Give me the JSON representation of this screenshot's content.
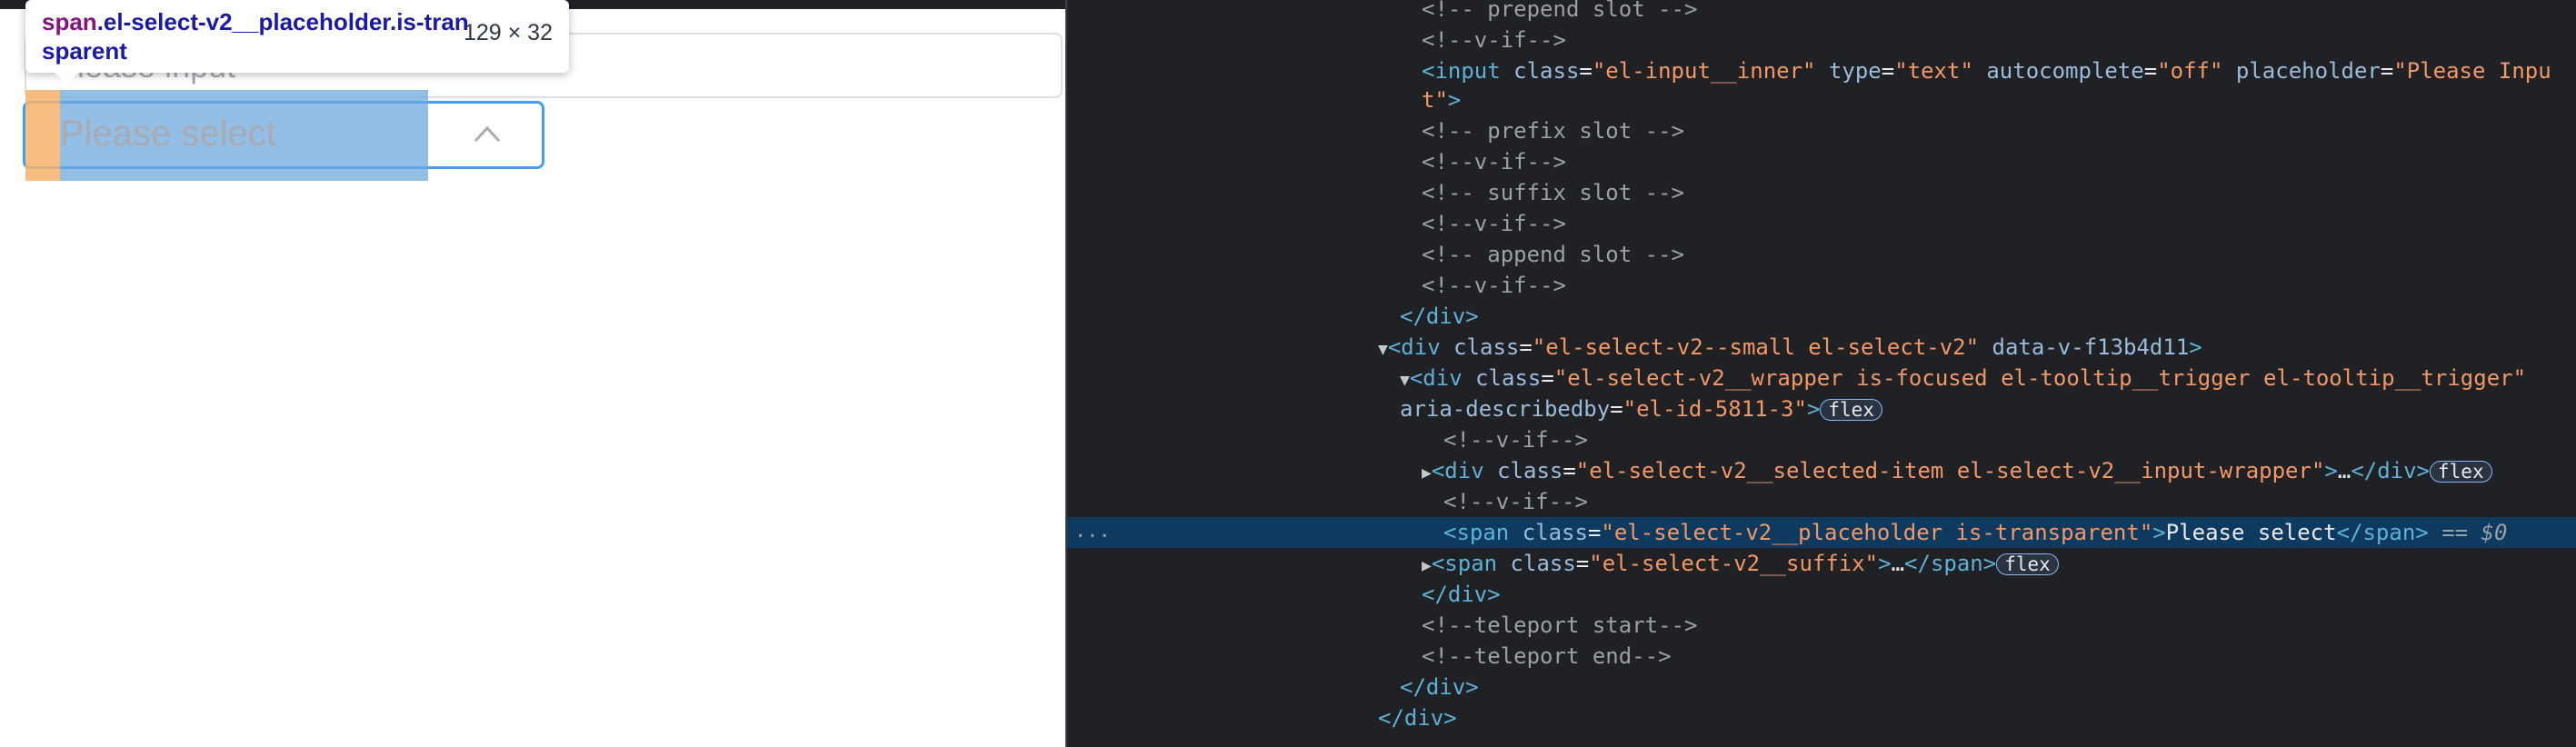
{
  "preview": {
    "text_input_placeholder": "Please input",
    "select_placeholder": "Please select"
  },
  "tooltip": {
    "tag": "span",
    "selector": ".el-select-v2__placeholder.is-transparent",
    "size": "129 × 32"
  },
  "devtools": {
    "lines": [
      "<!-- prepend slot -->",
      "<!--v-if-->",
      "<input class=\"el-input__inner\" type=\"text\" autocomplete=\"off\" placeholder=\"Please Input\">",
      "<!-- prefix slot -->",
      "<!--v-if-->",
      "<!-- suffix slot -->",
      "<!--v-if-->",
      "<!-- append slot -->",
      "<!--v-if-->",
      "</div>",
      "<div class=\"el-select-v2--small el-select-v2\" data-v-f13b4d11>",
      "<div class=\"el-select-v2__wrapper is-focused el-tooltip__trigger el-tooltip__trigger\" aria-describedby=\"el-id-5811-3\">",
      "<!--v-if-->",
      "<div class=\"el-select-v2__selected-item el-select-v2__input-wrapper\">…</div>",
      "<!--v-if-->",
      "<span class=\"el-select-v2__placeholder is-transparent\">Please select</span>",
      "<span class=\"el-select-v2__suffix\">…</span>",
      "</div>",
      "<!--teleport start-->",
      "<!--teleport end-->",
      "</div>",
      "</div>"
    ],
    "flex_badge": "flex",
    "selected_marker": "== $0",
    "overflow_dots": "···"
  },
  "colors": {
    "panel_bg": "#202124",
    "selected_row": "#0f3a5f",
    "tag": "#5db0d7",
    "attr_name": "#9bbbdc",
    "attr_value": "#f29766",
    "comment": "#9aa0a6",
    "focus_border": "#409eff"
  }
}
